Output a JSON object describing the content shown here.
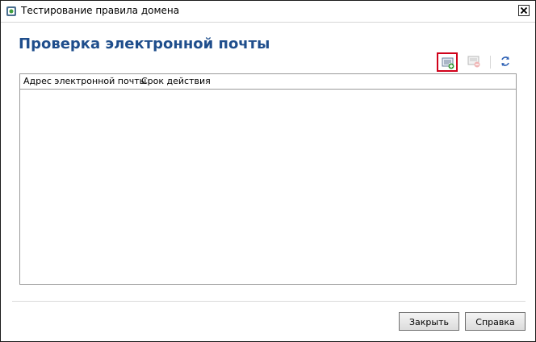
{
  "window": {
    "title": "Тестирование правила домена",
    "close_glyph": "✕"
  },
  "page": {
    "heading": "Проверка электронной почты"
  },
  "toolbar": {
    "icons": [
      "add-email-icon",
      "remove-email-icon",
      "refresh-icon"
    ]
  },
  "list": {
    "columns": [
      "Адрес электронной почты",
      "Срок действия"
    ],
    "rows": []
  },
  "buttons": {
    "close_label": "Закрыть",
    "help_label": "Справка"
  },
  "colors": {
    "heading": "#1f4e8c",
    "highlight": "#d0021b"
  }
}
